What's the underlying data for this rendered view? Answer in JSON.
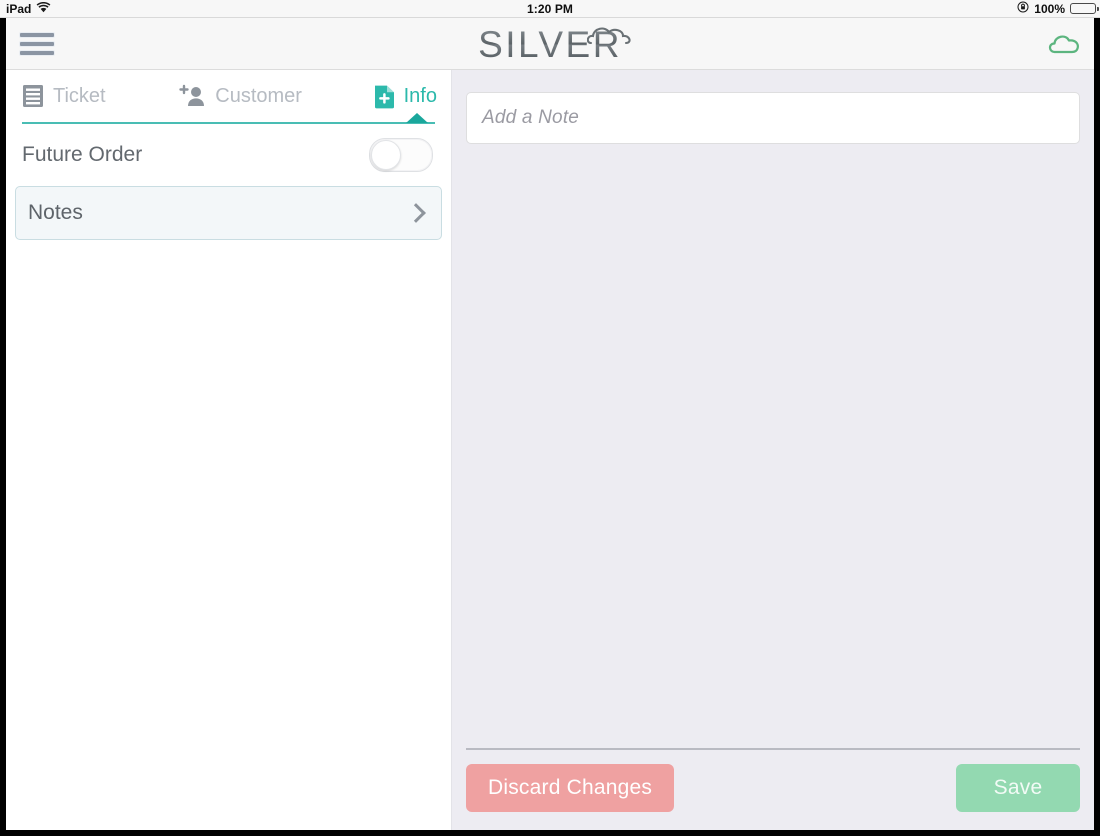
{
  "status_bar": {
    "device_label": "iPad",
    "wifi_icon": "wifi-icon",
    "time": "1:20 PM",
    "rotation_lock_icon": "rotation-lock-icon",
    "battery_percent": "100%",
    "battery_icon": "battery-full-icon",
    "battery_color": "#4cd764"
  },
  "header": {
    "menu_icon": "hamburger-menu-icon",
    "logo_text": "SILVER",
    "logo_cloud_icon": "cloud-icon",
    "sync_icon": "cloud-sync-icon",
    "sync_icon_color": "#5cb57f"
  },
  "tabs": [
    {
      "id": "ticket",
      "label": "Ticket",
      "icon": "receipt-icon",
      "active": false
    },
    {
      "id": "customer",
      "label": "Customer",
      "icon": "add-person-icon",
      "active": false
    },
    {
      "id": "info",
      "label": "Info",
      "icon": "note-add-icon",
      "active": true
    }
  ],
  "left_panel": {
    "future_order": {
      "label": "Future Order",
      "toggle_state": "off"
    },
    "notes": {
      "label": "Notes",
      "chevron_icon": "chevron-right-icon",
      "selected": true
    }
  },
  "right_panel": {
    "note_input_placeholder": "Add a Note",
    "note_input_value": "",
    "notes": []
  },
  "footer": {
    "discard_label": "Discard Changes",
    "discard_color": "#efa1a1",
    "save_label": "Save",
    "save_color": "#93d9b1"
  },
  "theme": {
    "accent_teal": "#2cb9ab",
    "underline_teal": "#49bdb4",
    "content_bg": "#edecf2",
    "panel_bg": "#ffffff"
  }
}
